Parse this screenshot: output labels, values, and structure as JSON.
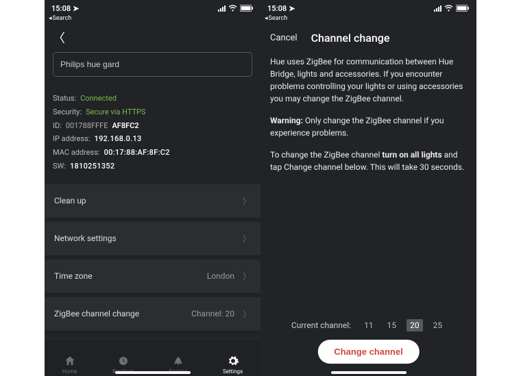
{
  "statusbar": {
    "time": "15:08",
    "search_back": "Search"
  },
  "left": {
    "bridge_name": "Philips hue gard",
    "status_label": "Status:",
    "status_value": "Connected",
    "security_label": "Security:",
    "security_value": "Secure via HTTPS",
    "id_label": "ID:",
    "id_prefix": "001788FFFE",
    "id_suffix": "AF8FC2",
    "ip_label": "IP address:",
    "ip_value": "192.168.0.13",
    "mac_label": "MAC address:",
    "mac_value": "00:17:88:AF:8F:C2",
    "sw_label": "SW:",
    "sw_value": "1810251352",
    "rows": {
      "clean": "Clean up",
      "network": "Network settings",
      "timezone": "Time zone",
      "timezone_value": "London",
      "zigbee": "ZigBee channel change",
      "zigbee_value": "Channel: 20"
    },
    "tabs": {
      "home": "Home",
      "routines": "Routines",
      "explore": "Explore",
      "settings": "Settings"
    }
  },
  "right": {
    "cancel": "Cancel",
    "title": "Channel change",
    "p1": "Hue uses ZigBee for communication between Hue Bridge, lights and accessories. If you encounter problems controlling your lights or using accessories you may change the ZigBee channel.",
    "p2a": "Warning:",
    "p2b": " Only change the ZigBee channel if you experience problems.",
    "p3a": "To change the ZigBee channel ",
    "p3b": "turn on all lights",
    "p3c": " and tap Change channel below. This will take 30 seconds.",
    "current_label": "Current channel:",
    "channels": {
      "c11": "11",
      "c15": "15",
      "c20": "20",
      "c25": "25"
    },
    "change_btn": "Change channel"
  }
}
